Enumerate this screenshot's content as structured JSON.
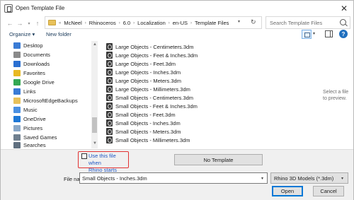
{
  "window": {
    "title": "Open Template File",
    "close_glyph": "✕"
  },
  "address": {
    "crumbs": [
      "McNeel",
      "Rhinoceros",
      "6.0",
      "Localization",
      "en-US",
      "Template Files"
    ],
    "search_placeholder": "Search Template Files"
  },
  "toolbar": {
    "organize": "Organize ▾",
    "new_folder": "New folder"
  },
  "nav": {
    "items": [
      {
        "label": "Desktop",
        "icon": "desktop-icon",
        "color": "#3a7bd5"
      },
      {
        "label": "Documents",
        "icon": "documents-icon",
        "color": "#8a8a8a"
      },
      {
        "label": "Downloads",
        "icon": "downloads-icon",
        "color": "#2a6fd1"
      },
      {
        "label": "Favorites",
        "icon": "star-icon",
        "color": "#e8b923"
      },
      {
        "label": "Google Drive",
        "icon": "google-drive-icon",
        "color": "#34a853"
      },
      {
        "label": "Links",
        "icon": "links-icon",
        "color": "#3a7bd5"
      },
      {
        "label": "MicrosoftEdgeBackups",
        "icon": "folder-icon",
        "color": "#e8c15a"
      },
      {
        "label": "Music",
        "icon": "music-icon",
        "color": "#4a90e2"
      },
      {
        "label": "OneDrive",
        "icon": "onedrive-icon",
        "color": "#1e78d6"
      },
      {
        "label": "Pictures",
        "icon": "pictures-icon",
        "color": "#8aa8c8"
      },
      {
        "label": "Saved Games",
        "icon": "saved-games-icon",
        "color": "#6f7f8f"
      },
      {
        "label": "Searches",
        "icon": "search-icon",
        "color": "#5f6f7f"
      }
    ]
  },
  "files": [
    "Large Objects - Centimeters.3dm",
    "Large Objects - Feet & Inches.3dm",
    "Large Objects - Feet.3dm",
    "Large Objects - Inches.3dm",
    "Large Objects - Meters.3dm",
    "Large Objects - Millimeters.3dm",
    "Small Objects - Centimeters.3dm",
    "Small Objects - Feet & Inches.3dm",
    "Small Objects - Feet.3dm",
    "Small Objects - Inches.3dm",
    "Small Objects - Meters.3dm",
    "Small Objects - Millimeters.3dm"
  ],
  "preview_text": "Select a file to preview.",
  "bottom": {
    "use_when_starts_line1": "Use this file when",
    "use_when_starts_line2": "Rhino starts",
    "no_template": "No Template",
    "file_name_label": "File name:",
    "file_name_value": "Small Objects - Inches.3dm",
    "file_type": "Rhino 3D Models (*.3dm)",
    "open": "Open",
    "cancel": "Cancel"
  }
}
